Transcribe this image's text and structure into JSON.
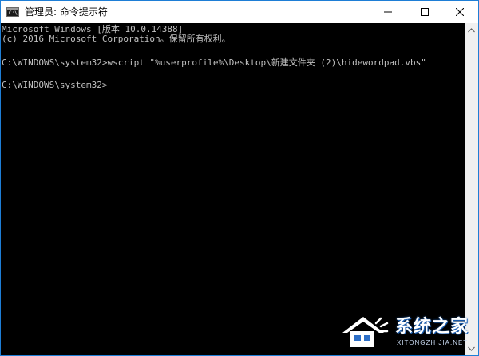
{
  "window": {
    "title": "管理员: 命令提示符",
    "app_icon_glyph": "C:\\",
    "controls": {
      "minimize": "minimize-icon",
      "maximize": "maximize-icon",
      "close": "close-icon"
    }
  },
  "console": {
    "lines": [
      "Microsoft Windows [版本 10.0.14388]",
      "(c) 2016 Microsoft Corporation。保留所有权利。",
      "C:\\WINDOWS\\system32>wscript \"%userprofile%\\Desktop\\新建文件夹 (2)\\hidewordpad.vbs\"",
      "C:\\WINDOWS\\system32>"
    ],
    "text_color": "#c0c0c0",
    "background": "#000000"
  },
  "watermark": {
    "brand": "系统之家",
    "domain": "XITONGZHIJIA.NET"
  },
  "colors": {
    "accent_border": "#1e7ed6"
  }
}
